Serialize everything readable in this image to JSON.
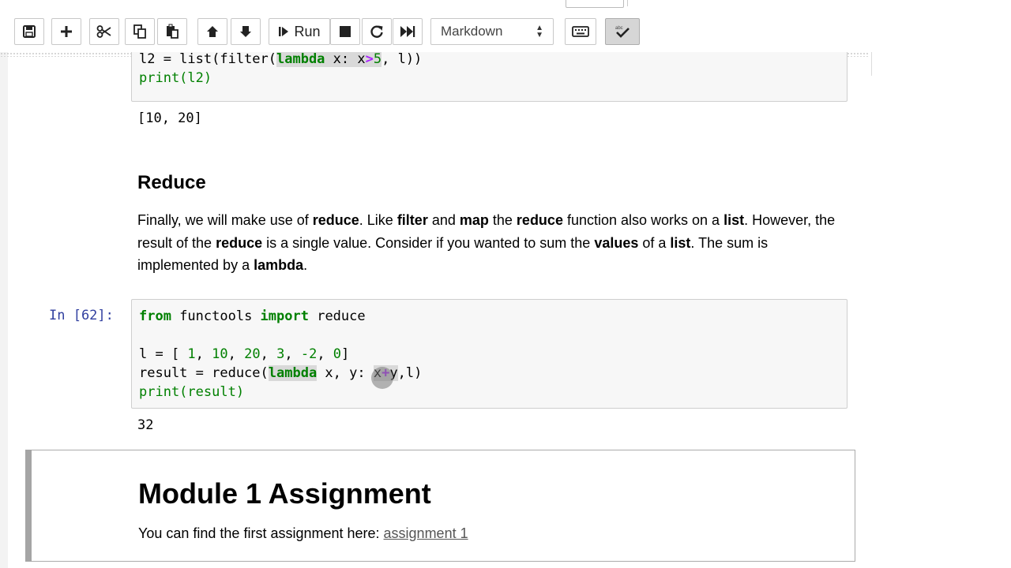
{
  "toolbar": {
    "buttons": [
      {
        "name": "save",
        "icon": "save-icon"
      },
      {
        "name": "insert-cell",
        "icon": "plus-icon"
      },
      {
        "name": "cut",
        "icon": "scissors-icon"
      },
      {
        "name": "copy",
        "icon": "copy-icon"
      },
      {
        "name": "paste",
        "icon": "paste-icon"
      },
      {
        "name": "move-up",
        "icon": "arrow-up-icon"
      },
      {
        "name": "move-down",
        "icon": "arrow-down-icon"
      },
      {
        "name": "run",
        "icon": "step-forward-icon"
      },
      {
        "name": "interrupt",
        "icon": "stop-icon"
      },
      {
        "name": "restart",
        "icon": "refresh-icon"
      },
      {
        "name": "restart-run-all",
        "icon": "fast-forward-icon"
      },
      {
        "name": "command-palette",
        "icon": "keyboard-icon"
      },
      {
        "name": "spellcheck",
        "icon": "spellcheck-icon"
      }
    ],
    "run_label": "Run",
    "cell_type": "Markdown"
  },
  "cells": {
    "filter_code": {
      "line1": "l2 = list(filter(",
      "lambda_kw": "lambda",
      "line1_b": " x: x",
      "op": ">",
      "five": "5",
      "line1_c": ", l))",
      "line2": "print(l2)"
    },
    "filter_output": "[10, 20]",
    "reduce_heading": "Reduce",
    "reduce_text": {
      "s1": "Finally, we will make use of ",
      "b1": "reduce",
      "s2": ". Like ",
      "b2": "filter",
      "s3": " and ",
      "b3": "map",
      "s4": " the ",
      "b4": "reduce",
      "s5": " function also works on a ",
      "b5": "list",
      "s6": ". However, the result of the ",
      "b6": "reduce",
      "s7": " is a single value. Consider if you wanted to sum the ",
      "b7": "values",
      "s8": " of a ",
      "b8": "list",
      "s9": ". The sum is implemented by a ",
      "b9": "lambda",
      "s10": "."
    },
    "reduce_prompt": "In [62]:",
    "reduce_code": {
      "from": "from",
      "functools": " functools ",
      "import": "import",
      "reduce": " reduce",
      "l_assign": "l = [ ",
      "n1": "1",
      "n2": "10",
      "n3": "20",
      "n4": "3",
      "n5": "-2",
      "n6": "0",
      "comma": ", ",
      "close": "]",
      "result": "result = reduce(",
      "lambda_kw": "lambda",
      "params": " x, y: ",
      "expr_x": "x",
      "plus": "+",
      "expr_y": "y",
      "tail": ",l)",
      "print": "print(result)"
    },
    "reduce_output": "32",
    "assignment_heading": "Module 1 Assignment",
    "assignment_text": "You can find the first assignment here: ",
    "assignment_link": "assignment 1"
  }
}
